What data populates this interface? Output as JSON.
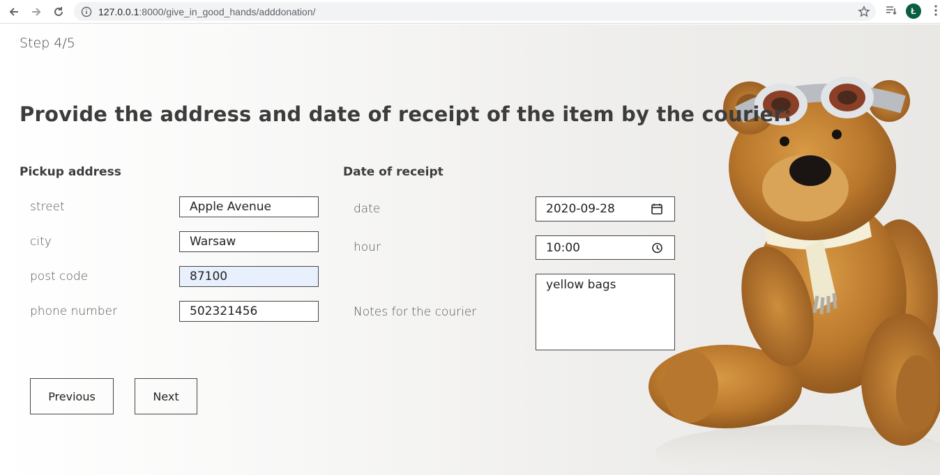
{
  "browser": {
    "url_host": "127.0.0.1",
    "url_rest": ":8000/give_in_good_hands/adddonation/",
    "profile_initial": "Ł"
  },
  "form": {
    "step": "Step 4/5",
    "heading": "Provide the address and date of receipt of the item by the courier:",
    "pickup": {
      "title": "Pickup address",
      "street_label": "street",
      "street_value": "Apple Avenue",
      "city_label": "city",
      "city_value": "Warsaw",
      "postcode_label": "post code",
      "postcode_value": "87100",
      "phone_label": "phone number",
      "phone_value": "502321456"
    },
    "receipt": {
      "title": "Date of receipt",
      "date_label": "date",
      "date_value": "2020-09-28",
      "hour_label": "hour",
      "hour_value": "10:00",
      "notes_label": "Notes for the courier",
      "notes_value": "yellow bags"
    },
    "buttons": {
      "previous": "Previous",
      "next": "Next"
    }
  },
  "colors": {
    "text": "#333333",
    "avatar": "#0b5d42"
  }
}
